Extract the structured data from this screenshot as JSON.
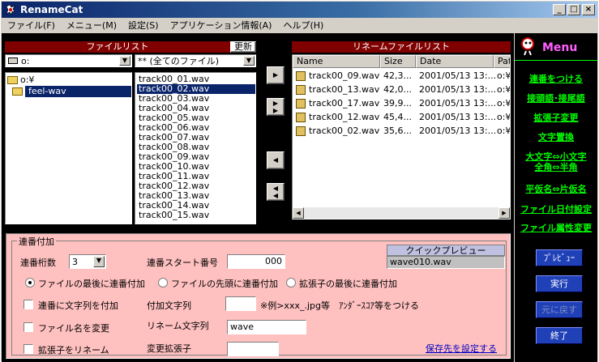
{
  "window": {
    "title": "RenameCat"
  },
  "menu": [
    "ファイル(F)",
    "メニュー(M)",
    "設定(S)",
    "アプリケーション情報(A)",
    "ヘルプ(H)"
  ],
  "filelist": {
    "label": "ファイルリスト",
    "refresh": "更新",
    "drive": "o:",
    "filter": "** (全てのファイル)",
    "folders": [
      {
        "name": "o:¥",
        "selected": false
      },
      {
        "name": "feel-wav",
        "selected": true
      }
    ],
    "files": [
      {
        "name": "track00_01.wav",
        "selected": false
      },
      {
        "name": "track00_02.wav",
        "selected": true
      },
      {
        "name": "track00_03.wav",
        "selected": false
      },
      {
        "name": "track00_04.wav",
        "selected": false
      },
      {
        "name": "track00_05.wav",
        "selected": false
      },
      {
        "name": "track00_06.wav",
        "selected": false
      },
      {
        "name": "track00_07.wav",
        "selected": false
      },
      {
        "name": "track00_08.wav",
        "selected": false
      },
      {
        "name": "track00_09.wav",
        "selected": false
      },
      {
        "name": "track00_10.wav",
        "selected": false
      },
      {
        "name": "track00_11.wav",
        "selected": false
      },
      {
        "name": "track00_12.wav",
        "selected": false
      },
      {
        "name": "track00_13.wav",
        "selected": false
      },
      {
        "name": "track00_14.wav",
        "selected": false
      },
      {
        "name": "track00_15.wav",
        "selected": false
      }
    ]
  },
  "renamelist": {
    "label": "リネームファイルリスト",
    "columns": [
      "Name",
      "Size",
      "Date",
      "Pat"
    ],
    "rows": [
      {
        "name": "track00_09.wav",
        "size": "42,3...",
        "date": "2001/05/13 13:...",
        "path": "o:¥"
      },
      {
        "name": "track00_13.wav",
        "size": "42,0...",
        "date": "2001/05/13 13:...",
        "path": "o:¥"
      },
      {
        "name": "track00_17.wav",
        "size": "39,9...",
        "date": "2001/05/13 13:...",
        "path": "o:¥"
      },
      {
        "name": "track00_12.wav",
        "size": "45,4...",
        "date": "2001/05/13 13:...",
        "path": "o:¥"
      },
      {
        "name": "track00_02.wav",
        "size": "35,6...",
        "date": "2001/05/13 13:...",
        "path": "o:¥"
      }
    ]
  },
  "sidebar": {
    "menu_title": "Menu",
    "links": [
      "連番をつける",
      "接頭語･接尾語",
      "拡張子変更",
      "文字置換",
      "大文字⇔小文字",
      "全角⇔半角",
      "平仮名⇔片仮名",
      "ファイル日付設定",
      "ファイル属性変更"
    ],
    "buttons": [
      "ﾌﾟﾚﾋﾞｭｰ",
      "実行",
      "元に戻す",
      "終了"
    ]
  },
  "numbering": {
    "group_label": "連番付加",
    "digits_label": "連番桁数",
    "digits_value": "3",
    "start_label": "連番スタート番号",
    "start_value": "000",
    "preview_label": "クイックプレビュー",
    "preview_value": "wave010.wav",
    "radio_end": "ファイルの最後に連番付加",
    "radio_start": "ファイルの先頭に連番付加",
    "radio_ext": "拡張子の最後に連番付加",
    "chk_text": "連番に文字列を付加",
    "add_text_label": "付加文字列",
    "add_text_value": "",
    "note": "※例>xxx_.jpg等　ｱﾝﾀﾞｰｽｺｱ等をつける",
    "chk_rename": "ファイル名を変更",
    "rename_label": "リネーム文字列",
    "rename_value": "wave",
    "chk_ext": "拡張子をリネーム",
    "ext_label": "変更拡張子",
    "ext_value": "",
    "save_link": "保存先を設定する"
  }
}
